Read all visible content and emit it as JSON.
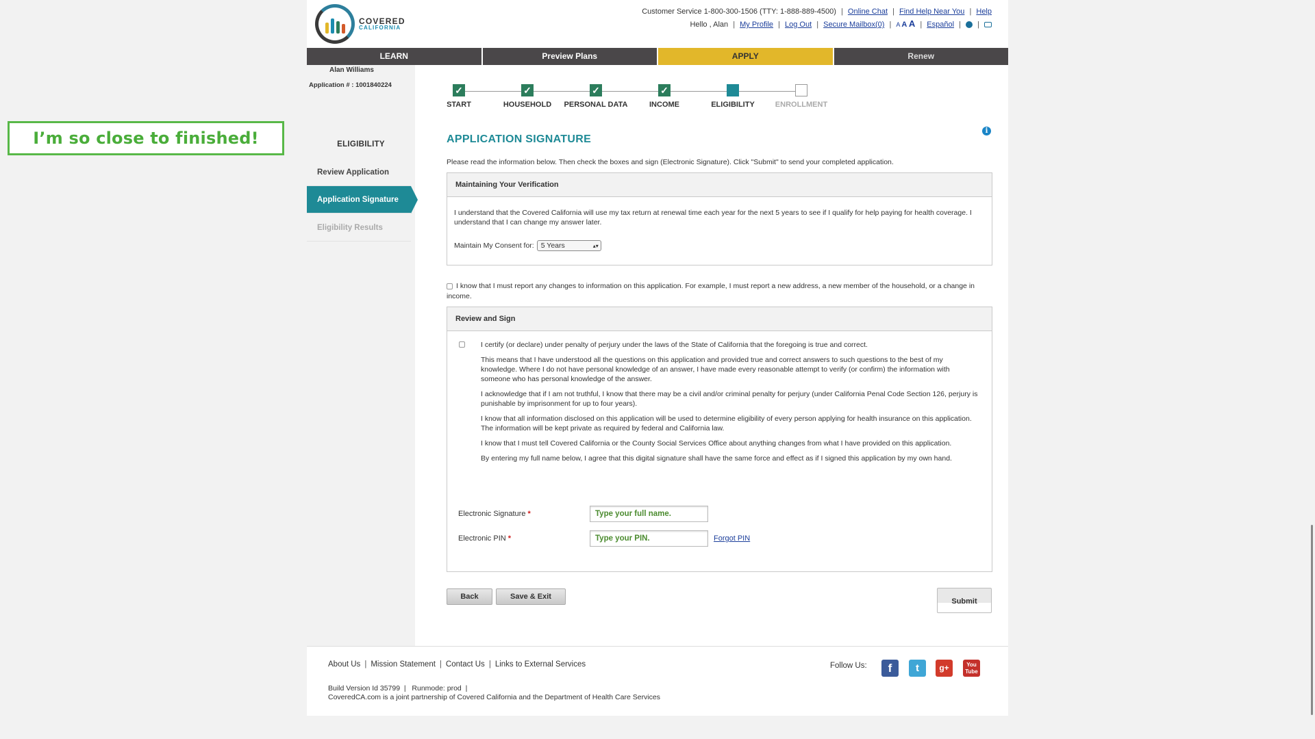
{
  "annotation": {
    "text": "I’m so close to finished!"
  },
  "header": {
    "logo": {
      "line1": "COVERED",
      "line2": "CALIFORNIA"
    },
    "customer_service": "Customer Service 1-800-300-1506 (TTY: 1-888-889-4500)",
    "links_row1": [
      "Online Chat",
      "Find Help Near You",
      "Help"
    ],
    "greeting": "Hello , Alan",
    "links_row2": [
      "My Profile",
      "Log Out",
      "Secure Mailbox(0)"
    ],
    "text_size": {
      "small": "A",
      "medium": "A",
      "large": "A"
    },
    "language": "Español",
    "icons": [
      "globe-icon",
      "print-icon"
    ]
  },
  "nav": {
    "tabs": [
      "LEARN",
      "Preview Plans",
      "APPLY",
      "Renew"
    ],
    "active": "APPLY"
  },
  "sidebar": {
    "user_name": "Alan Williams",
    "application_number": "Application # : 1001840224",
    "title": "ELIGIBILITY",
    "items": [
      {
        "label": "Review Application",
        "state": "normal"
      },
      {
        "label": "Application Signature",
        "state": "active"
      },
      {
        "label": "Eligibility Results",
        "state": "disabled"
      }
    ]
  },
  "progress": {
    "steps": [
      {
        "label": "START",
        "state": "complete",
        "mark": "✓"
      },
      {
        "label": "HOUSEHOLD",
        "state": "complete",
        "mark": "✓"
      },
      {
        "label": "PERSONAL DATA",
        "state": "complete",
        "mark": "✓"
      },
      {
        "label": "INCOME",
        "state": "complete",
        "mark": "✓"
      },
      {
        "label": "ELIGIBILITY",
        "state": "current",
        "mark": ""
      },
      {
        "label": "ENROLLMENT",
        "state": "upcoming",
        "mark": ""
      }
    ]
  },
  "main": {
    "title": "APPLICATION SIGNATURE",
    "info_icon": "i",
    "intro": "Please read the information below. Then check the boxes and sign (Electronic Signature). Click \"Submit\" to send your completed application.",
    "verification": {
      "heading": "Maintaining Your Verification",
      "text": "I understand that the Covered California will use my tax return at renewal time each year for the next 5 years to see if I qualify for help paying for health coverage. I understand that I can change my answer later.",
      "consent_label": "Maintain My Consent for:",
      "consent_value": "5 Years"
    },
    "report_changes": "I know that I must report any changes to information on this application. For example, I must report a new address, a new member of the household, or a change in income.",
    "review_sign": {
      "heading": "Review and Sign",
      "certify": "I certify (or declare) under penalty of perjury under the laws of the State of California that the foregoing is true and correct.",
      "paragraphs": [
        "This means that I have understood all the questions on this application and provided true and correct answers to such questions to the best of my knowledge. Where I do not have personal knowledge of an answer, I have made every reasonable attempt to verify (or confirm) the information with someone who has personal knowledge of the answer.",
        "I acknowledge that if I am not truthful, I know that there may be a civil and/or criminal penalty for perjury (under California Penal Code Section 126, perjury is punishable by imprisonment for up to four years).",
        "I know that all information disclosed on this application will be used to determine eligibility of every person applying for health insurance on this application. The information will be kept private as required by federal and California law.",
        "I know that I must tell Covered California or the County Social Services Office about anything changes from what I have provided on this application.",
        "By entering my full name below, I agree that this digital signature shall have the same force and effect as if I signed this application by my own hand."
      ],
      "signature_label": "Electronic Signature",
      "signature_placeholder": "Type your full name.",
      "pin_label": "Electronic PIN",
      "pin_placeholder": "Type your PIN.",
      "required_mark": "*",
      "forgot_pin": "Forgot PIN"
    },
    "buttons": {
      "back": "Back",
      "save_exit": "Save & Exit",
      "submit": "Submit"
    }
  },
  "footer": {
    "links": [
      "About Us",
      "Mission Statement",
      "Contact Us",
      "Links to External Services"
    ],
    "build": "Build Version Id 35799  |   Runmode: prod  |",
    "partnership": "CoveredCA.com is a joint partnership of Covered California and the Department of Health Care Services",
    "follow": "Follow Us:",
    "social": [
      {
        "name": "facebook-icon",
        "glyph": "f"
      },
      {
        "name": "twitter-icon",
        "glyph": "t"
      },
      {
        "name": "google-plus-icon",
        "glyph": "g+"
      },
      {
        "name": "youtube-icon",
        "glyph": "You Tube"
      }
    ]
  },
  "colors": {
    "teal": "#1e8a96",
    "apply_tab": "#e2b72a",
    "nav_bg": "#4a4749",
    "annotation_green": "#58b848"
  }
}
